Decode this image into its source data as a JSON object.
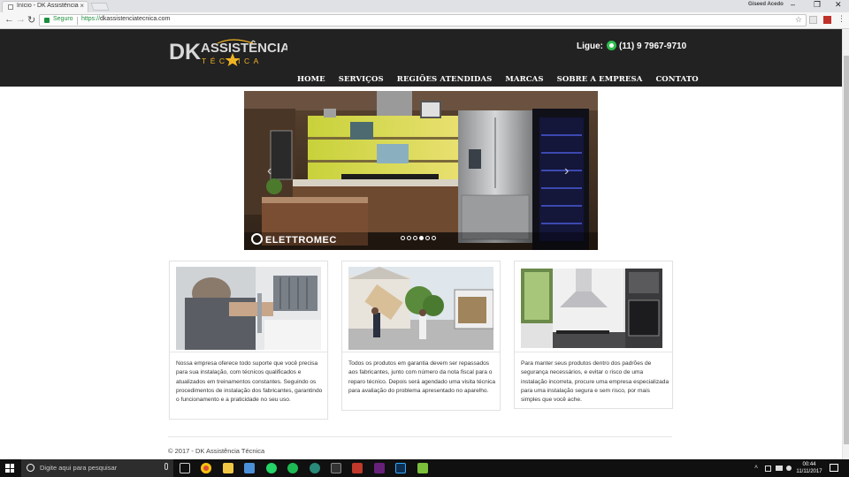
{
  "browser": {
    "tab_title": "Início - DK Assistência Té",
    "tab_close": "×",
    "profile_name": "Giseed Acedo",
    "win_min": "–",
    "win_max": "❐",
    "win_close": "✕",
    "nav_back": "←",
    "nav_forward": "→",
    "nav_reload": "↻",
    "secure_label": "Seguro",
    "url_proto": "https://",
    "url_host": "dkassistenciatecnica.com",
    "star": "☆"
  },
  "site": {
    "logo_dk": "DK",
    "logo_line1": "ASSISTÊNCIA",
    "logo_line2": "TÉCNICA",
    "phone_label": "Ligue:",
    "phone_number": "(11) 9 7967-9710",
    "nav": [
      "HOME",
      "SERVIÇOS",
      "REGIÕES ATENDIDAS",
      "MARCAS",
      "SOBRE A EMPRESA",
      "CONTATO"
    ],
    "carousel": {
      "brand": "ELETTROMEC",
      "prev_icon": "‹",
      "next_icon": "›",
      "slide_count": 6,
      "active_slide": 4
    },
    "cards": [
      {
        "text": "Nossa empresa oferece todo suporte que você precisa para sua instalação, com técnicos qualificados e atualizados em treinamentos constantes. Seguindo os procedimentos de instalação dos fabricantes, garantindo o funcionamento e a praticidade no seu uso."
      },
      {
        "text": "Todos os produtos em garantia devem ser repassados aos fabricantes, junto com número da nota fiscal para o reparo técnico. Depois será agendado uma visita técnica para avaliação do problema apresentado no aparelho."
      },
      {
        "text": "Para manter seus produtos dentro dos padrões de segurança necessários, e evitar o risco de uma instalação incorreta, procure uma empresa especializada para uma instalação segura e sem risco, por mais simples que você ache."
      }
    ],
    "footer": "© 2017 - DK Assistência Técnica"
  },
  "taskbar": {
    "search_placeholder": "Digite aqui para pesquisar",
    "time": "00:44",
    "date": "11/11/2017",
    "tray_up": "˄"
  },
  "colors": {
    "header_bg": "#222222",
    "logo_gold": "#f0b323",
    "secure_green": "#1e8e3e",
    "whatsapp_green": "#2fbd4e"
  }
}
